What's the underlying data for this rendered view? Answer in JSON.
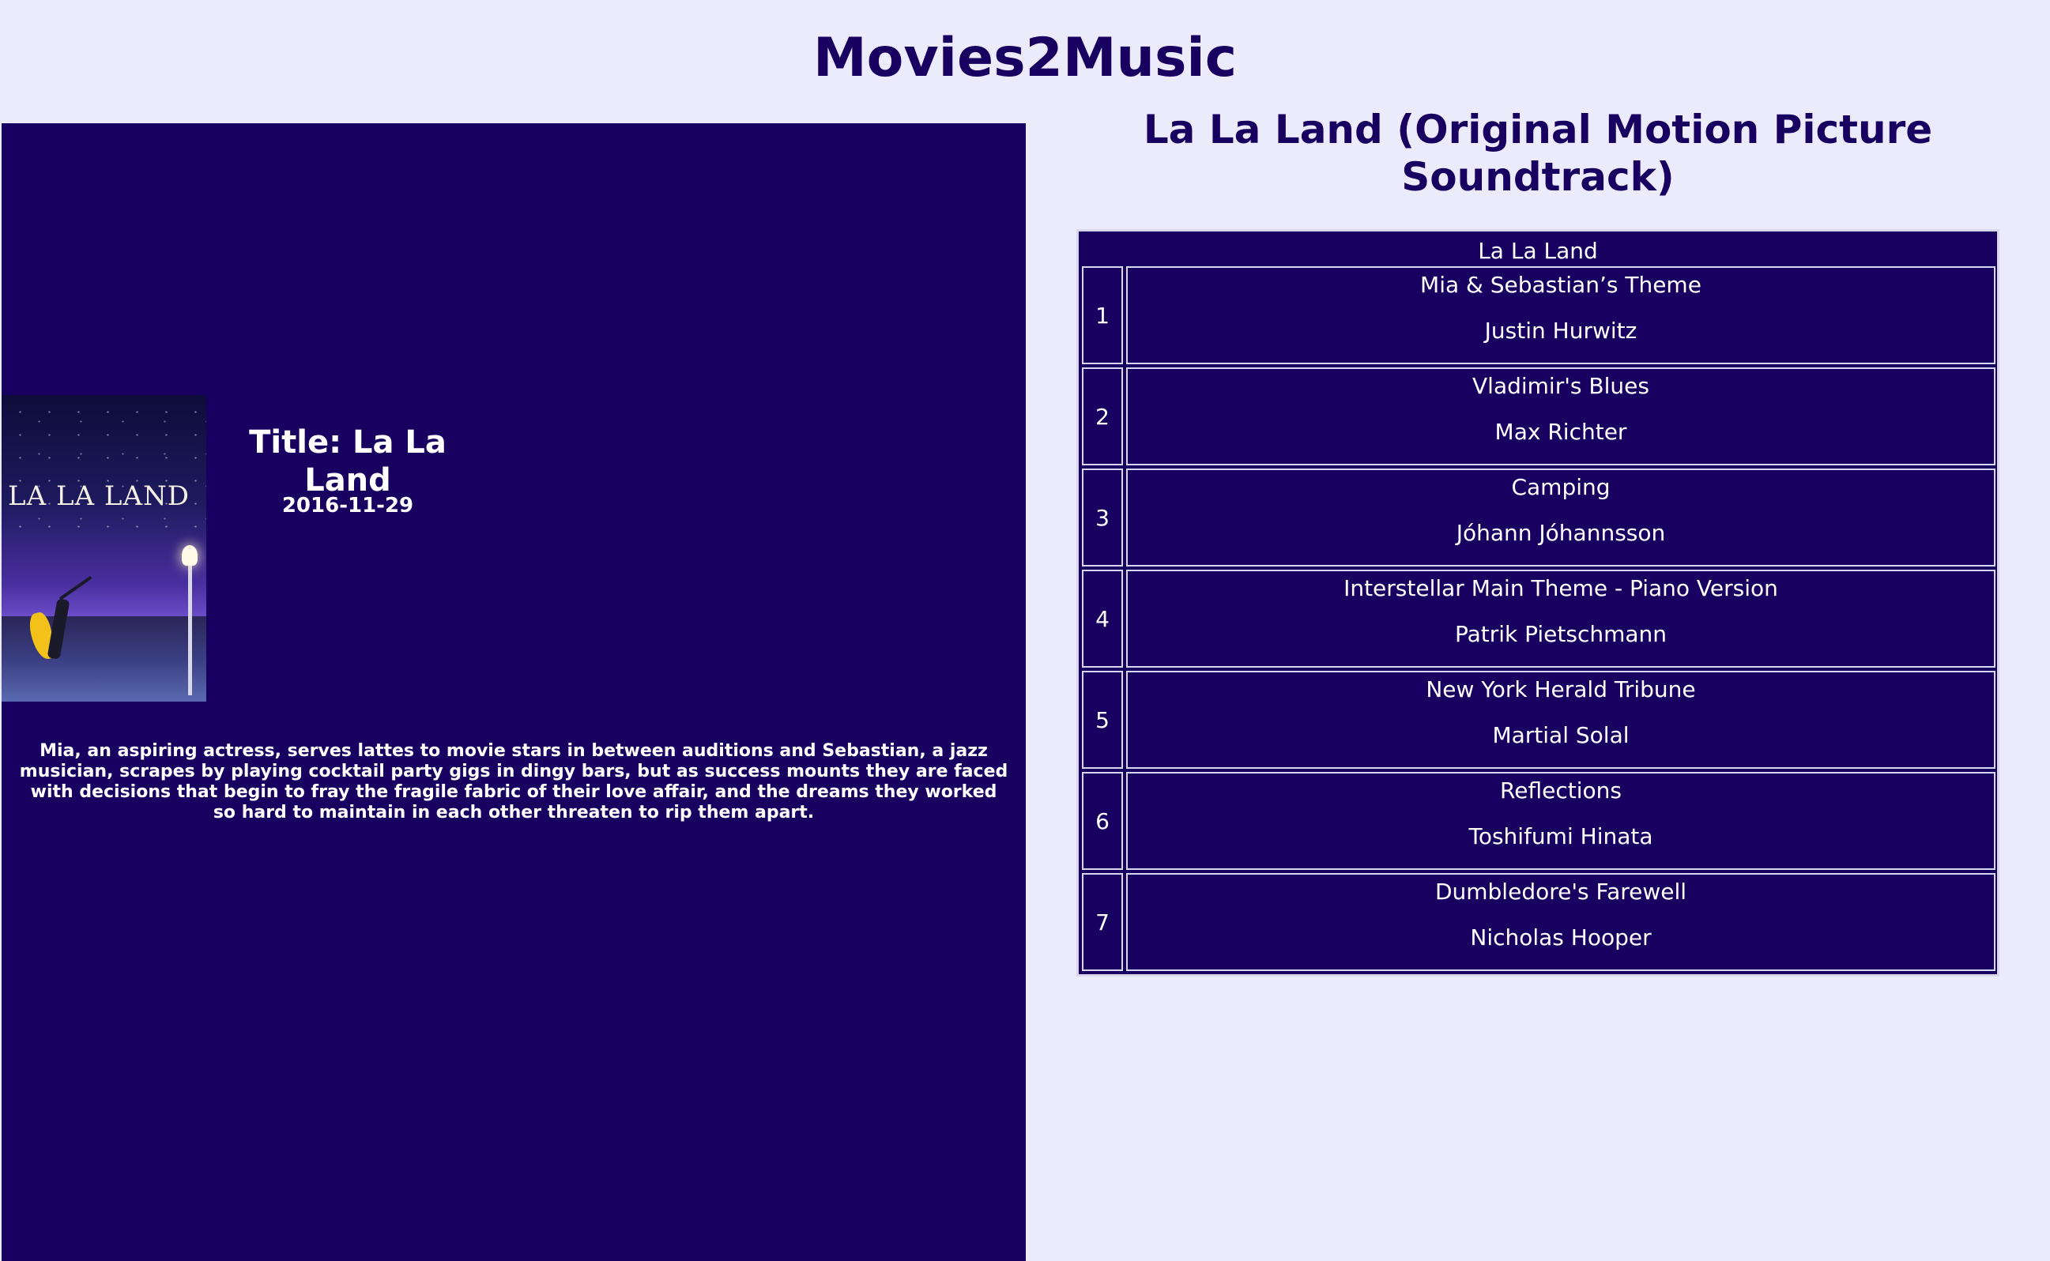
{
  "site": {
    "title": "Movies2Music"
  },
  "movie": {
    "poster_text": "LA LA LAND",
    "title": "Title: La La Land",
    "release_date": "2016-11-29",
    "overview": "Mia, an aspiring actress, serves lattes to movie stars in between auditions and Sebastian, a jazz musician, scrapes by playing cocktail party gigs in dingy bars, but as success mounts they are faced with decisions that begin to fray the fragile fabric of their love affair, and the dreams they worked so hard to maintain in each other threaten to rip them apart."
  },
  "soundtrack": {
    "title": "La La Land (Original Motion Picture Soundtrack)",
    "table_caption": "La La Land",
    "tracks": [
      {
        "number": "1",
        "name": "Mia & Sebastian’s Theme",
        "artist": "Justin Hurwitz"
      },
      {
        "number": "2",
        "name": "Vladimir's Blues",
        "artist": "Max Richter"
      },
      {
        "number": "3",
        "name": "Camping",
        "artist": "Jóhann Jóhannsson"
      },
      {
        "number": "4",
        "name": "Interstellar Main Theme - Piano Version",
        "artist": "Patrik Pietschmann"
      },
      {
        "number": "5",
        "name": "New York Herald Tribune",
        "artist": "Martial Solal"
      },
      {
        "number": "6",
        "name": "Reflections",
        "artist": "Toshifumi Hinata"
      },
      {
        "number": "7",
        "name": "Dumbledore's Farewell",
        "artist": "Nicholas Hooper"
      }
    ]
  }
}
